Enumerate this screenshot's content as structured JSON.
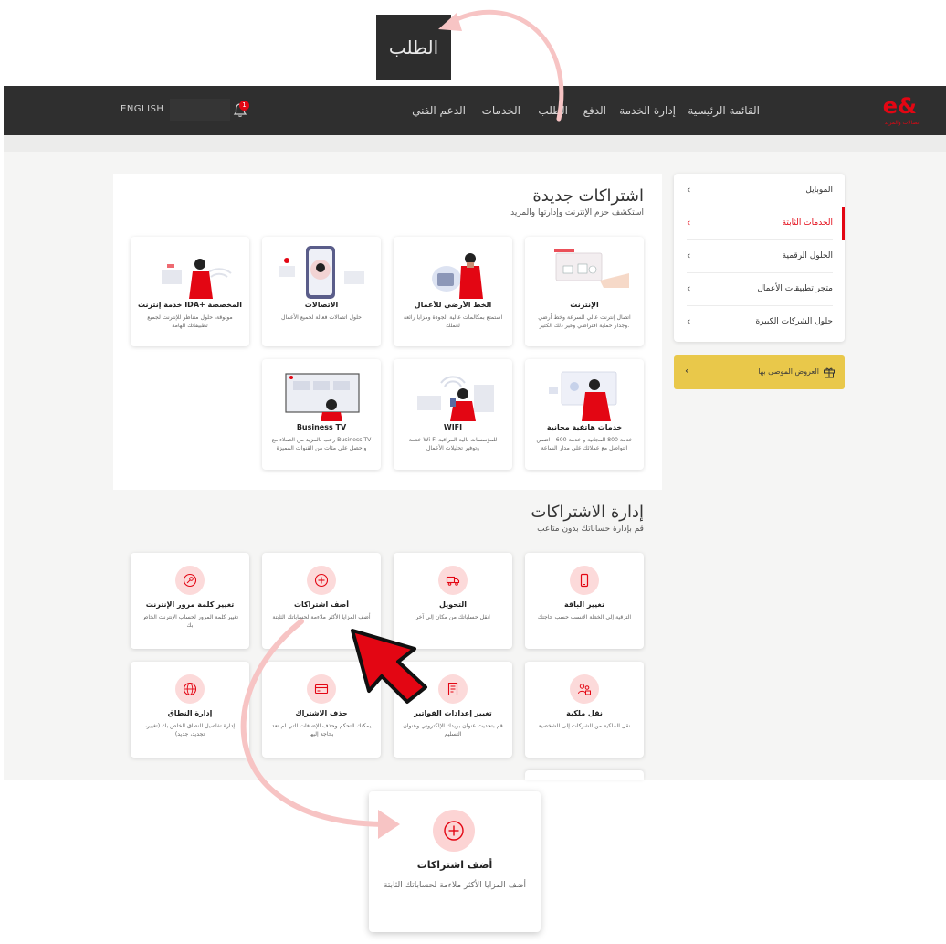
{
  "callout": {
    "label": "الطلب"
  },
  "brand": {
    "logo": "e&",
    "logo_sub": "اتصالات والمزيد"
  },
  "nav": {
    "items": [
      "القائمة الرئيسية",
      "إدارة الخدمة",
      "الدفع",
      "الطلب",
      "الخدمات",
      "الدعم الفني"
    ],
    "language": "ENGLISH",
    "notification_count": "1"
  },
  "sidebar": {
    "items": [
      {
        "label": "الموبايل",
        "active": false
      },
      {
        "label": "الخدمات الثابتة",
        "active": true
      },
      {
        "label": "الحلول الرقمية",
        "active": false
      },
      {
        "label": "متجر تطبيقات الأعمال",
        "active": false
      },
      {
        "label": "حلول الشركات الكبيرة",
        "active": false
      }
    ],
    "offers_label": "العروض الموصى بها"
  },
  "new_subs": {
    "title": "اشتراكات جديدة",
    "subtitle": "استكشف حزم الإنترنت وإدارتها والمزيد",
    "cards": [
      {
        "title": "الإنترنت",
        "desc": "اتصال إنترنت عالي السرعة وخط أرضي وجدار حماية افتراضي وغير ذلك الكثير."
      },
      {
        "title": "الخط الأرضي للأعمال",
        "desc": "استمتع بمكالمات عالية الجودة ومزايا رائعة لعملك"
      },
      {
        "title": "الاتصالات",
        "desc": "حلول اتصالات فعالة لجميع الأعمال"
      },
      {
        "title": "خدمة إنترنت IDA+ المخصصة",
        "desc": "موثوقة، حلول متناظر للإنترنت لجميع تطبيقاتك الهامة"
      },
      {
        "title": "خدمات هاتفية مجانية",
        "desc": "خدمة 800 المجانية و خدمة 600 - اضمن التواصل مع عملائك على مدار الساعة"
      },
      {
        "title": "WIFI",
        "desc": "خدمة Wi-Fi للمؤسسات بالية المراقبة وتوفير تحليلات الأعمال"
      },
      {
        "title": "Business TV",
        "desc": "رحب بالمزيد من العملاء مع Business TV واحصل على مئات من القنوات المميزة"
      }
    ]
  },
  "manage": {
    "title": "إدارة الاشتراكات",
    "subtitle": "قم بإدارة حساباتك بدون متاعب",
    "cards": [
      {
        "title": "تغيير الباقة",
        "desc": "الترقية إلى الخطة الأنسب حسب حاجتك",
        "icon": "phone-icon"
      },
      {
        "title": "التحويل",
        "desc": "انقل حساباتك من مكان إلى آخر",
        "icon": "truck-icon"
      },
      {
        "title": "أضف اشتراكات",
        "desc": "أضف المزايا الأكثر ملاءمة لحساباتك الثابتة",
        "icon": "plus-circle-icon"
      },
      {
        "title": "تغيير كلمة مرور الإنترنت",
        "desc": "تغيير كلمة المرور لحساب الإنترنت الخاص بك",
        "icon": "key-icon"
      },
      {
        "title": "نقل ملكية",
        "desc": "نقل الملكية من الشركات إلى الشخصية",
        "icon": "users-icon"
      },
      {
        "title": "تغيير إعدادات الفواتير",
        "desc": "قم بتحديث عنوان بريدك الإلكتروني وعنوان التسليم",
        "icon": "invoice-icon"
      },
      {
        "title": "حذف الاشتراك",
        "desc": "يمكنك التحكم وحذف الإضافات التي لم تعد بحاجة إليها",
        "icon": "card-icon"
      },
      {
        "title": "إدارة النطاق",
        "desc": "إدارة تفاصيل النطاق الخاص بك (تغيير، تجديد، جديد)",
        "icon": "globe-icon"
      }
    ]
  },
  "zoom": {
    "title": "أضف اشتراكات",
    "desc": "أضف المزايا الأكثر ملاءمة لحساباتك الثابتة"
  },
  "colors": {
    "brand_red": "#e30613",
    "dark_nav": "#2f2f2f",
    "offers_yellow": "#e9c84a",
    "icon_bg_pink": "#fcdada"
  }
}
